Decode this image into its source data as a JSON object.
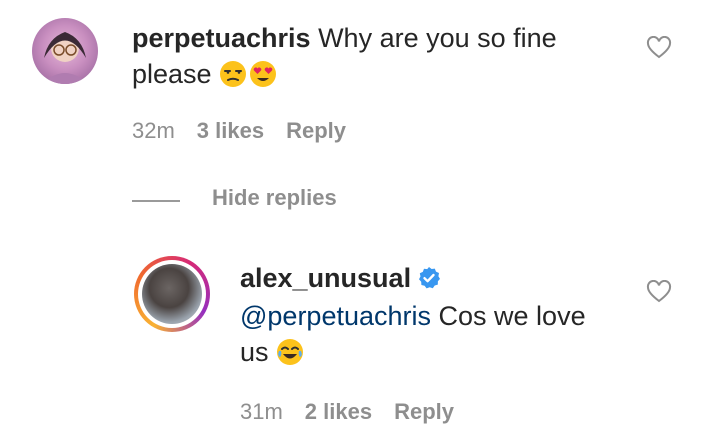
{
  "comment": {
    "username": "perpetuachris",
    "text_line1": " Why are you so fine",
    "text_line2": "please ",
    "emojis": [
      "unamused-face",
      "heart-eyes-face"
    ],
    "time": "32m",
    "likes": "3 likes",
    "reply_label": "Reply"
  },
  "hide_replies_label": "Hide replies",
  "reply": {
    "username": "alex_unusual",
    "verified": true,
    "mention": "@perpetuachris",
    "text_line1": " Cos we love",
    "text_line2": "us ",
    "emojis": [
      "tears-of-joy-face"
    ],
    "time": "31m",
    "likes": "2 likes",
    "reply_label": "Reply"
  },
  "colors": {
    "text": "#262626",
    "meta": "#8e8e8e",
    "mention": "#00376b",
    "verified": "#3897f0"
  }
}
